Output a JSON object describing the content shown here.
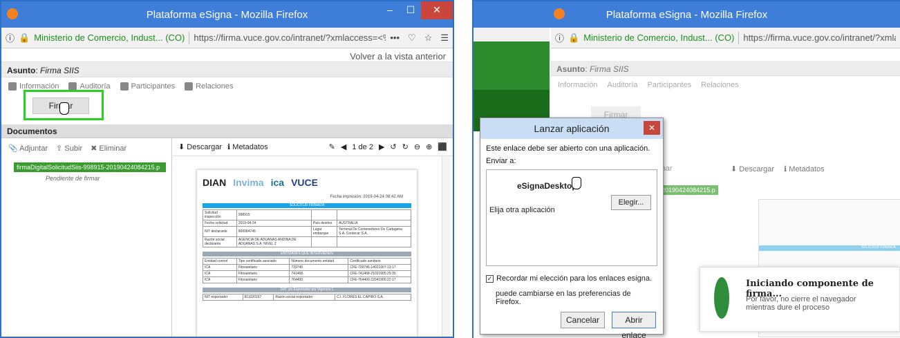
{
  "left": {
    "title": "Plataforma eSigna - Mozilla Firefox",
    "org": "Ministerio de Comercio, Indust... (CO)",
    "url": "https://firma.vuce.gov.co/intranet/?xmlaccess=<%3Fxml+version%",
    "back": "Volver a la vista anterior",
    "asunto_label": "Asunto",
    "asunto_value": "Firma SIIS",
    "tabs": [
      "Información",
      "Auditoría",
      "Participantes",
      "Relaciones"
    ],
    "firmar": "Firmar",
    "documentos": "Documentos",
    "doc_tools": [
      "Adjuntar",
      "Subir",
      "Eliminar"
    ],
    "doc_file": "firmaDigitalSolicitudSiis-998915-20190424084215.p",
    "doc_status": "Pendiente de firmar",
    "viewer": {
      "descargar": "Descargar",
      "metadatos": "Metadatos",
      "pager": "1 de 2"
    },
    "page": {
      "logos": [
        "DIAN",
        "Invima",
        "ica",
        "VUCE"
      ],
      "fecha": "Fecha impresión: 2019-04-24 08:42 AM",
      "bar1": "SOLICITUD FIRMADA",
      "rows": [
        [
          "Solicitud inspección",
          "998915",
          "",
          ""
        ],
        [
          "Fecha solicitud",
          "2019-04-24",
          "País destino",
          "AUSTRALIA"
        ],
        [
          "NIT declarante",
          "800084745",
          "Lugar embarque",
          "Terminal De Contenedores De Cartagena S.A. Contecar S.A."
        ],
        [
          "Razón social declarante",
          "AGENCIA DE ADUANAS ANDINA DE ADUANAS S.A. NIVEL 2",
          "",
          ""
        ]
      ],
      "bar2": "ENTIDADES QUE INTERVIENEN",
      "thead": [
        "Entidad control",
        "Tipo certificado asociado",
        "Número documento entidad",
        "Certificado sanitario"
      ],
      "trows": [
        [
          "ICA",
          "Fitosanitario",
          "739746",
          "CFE-739746-14021907:13:17"
        ],
        [
          "ICA",
          "Fitosanitario",
          "741468",
          "CFE-741468-21021905:29:30"
        ],
        [
          "ICA",
          "Fitosanitario",
          "764400",
          "CFE-764400-22041905:22:17"
        ]
      ],
      "bar3": "DAT y/o Exportador por Vigencia 1",
      "nit_exp": "NIT exportador",
      "nit_val": "811020167",
      "razon_exp": "Razón social exportador",
      "razon_val": "C.I. FLORES EL CAPIRO S.A."
    }
  },
  "right": {
    "title": "Plataforma eSigna - Mozilla Firefox",
    "org": "Ministerio de Comercio, Indust... (CO)",
    "url": "https://firma.vuce.gov.co/intranet/?xmlaccess=<%",
    "asunto_label": "Asunto",
    "asunto_value": "Firma SIIS",
    "tabs": [
      "Información",
      "Auditoría",
      "Participantes",
      "Relaciones"
    ],
    "firmar": "Firmar",
    "frag1": "minar",
    "frag2": "5-20190424084215.p",
    "descargar": "Descargar",
    "metadatos": "Metadatos",
    "solicitud": "SOLICITUD FIRMADA",
    "dialog": {
      "title": "Lanzar aplicación",
      "text1": "Este enlace debe ser abierto con una aplicación.",
      "text2": "Enviar a:",
      "app": "eSignaDesktop",
      "other": "Elija otra aplicación",
      "elegir": "Elegir...",
      "remember": "Recordar mi elección para los enlaces esigna.",
      "change": "puede cambiarse en las preferencias de Firefox.",
      "cancel": "Cancelar",
      "open": "Abrir enlace"
    },
    "toast": {
      "title": "Iniciando componente de firma...",
      "sub": "Por favor, no cierre el navegador mientras dure el proceso"
    }
  }
}
